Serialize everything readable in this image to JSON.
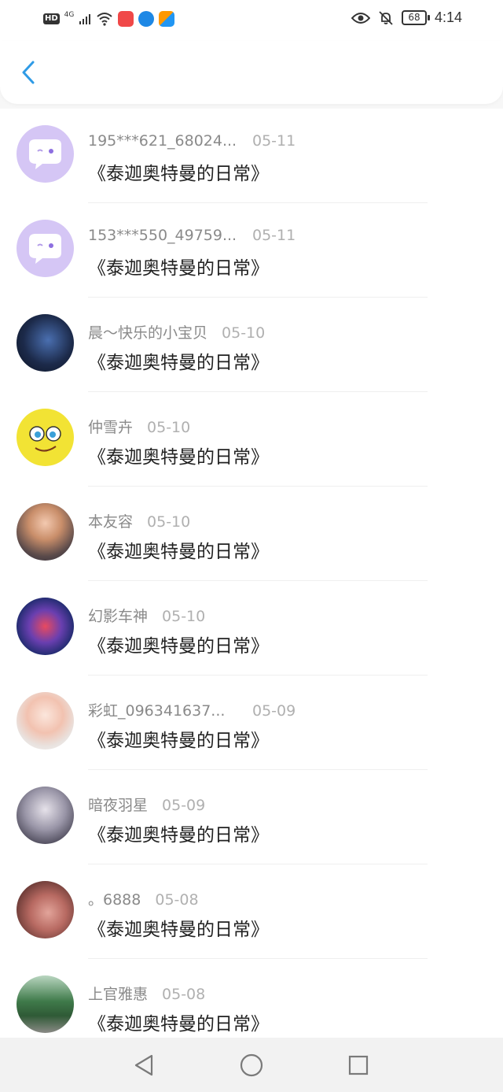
{
  "status": {
    "left_icons": [
      "hd-icon",
      "4g-signal-icon",
      "wifi-icon",
      "app-icon-shop",
      "app-icon-bulb",
      "app-icon-store"
    ],
    "hd_label": "HD",
    "net_label": "4G",
    "battery": "68",
    "time": "4:14"
  },
  "header": {
    "back_icon": "chevron-left-icon",
    "accent": "#2f9be6"
  },
  "items": [
    {
      "name": "195***621_68024...",
      "date": "05-11",
      "title": "《泰迦奥特曼的日常》",
      "avatar": "default-purple"
    },
    {
      "name": "153***550_49759...",
      "date": "05-11",
      "title": "《泰迦奥特曼的日常》",
      "avatar": "default-purple"
    },
    {
      "name": "晨～快乐的小宝贝",
      "date": "05-10",
      "title": "《泰迦奥特曼的日常》",
      "avatar": "photo"
    },
    {
      "name": "仲雪卉",
      "date": "05-10",
      "title": "《泰迦奥特曼的日常》",
      "avatar": "photo"
    },
    {
      "name": "本友容",
      "date": "05-10",
      "title": "《泰迦奥特曼的日常》",
      "avatar": "photo"
    },
    {
      "name": "幻影车神",
      "date": "05-10",
      "title": "《泰迦奥特曼的日常》",
      "avatar": "photo"
    },
    {
      "name": "彩虹_096341637...",
      "date": "05-09",
      "title": "《泰迦奥特曼的日常》",
      "avatar": "photo"
    },
    {
      "name": "暗夜羽星",
      "date": "05-09",
      "title": "《泰迦奥特曼的日常》",
      "avatar": "photo"
    },
    {
      "name": "。6888",
      "date": "05-08",
      "title": "《泰迦奥特曼的日常》",
      "avatar": "photo"
    },
    {
      "name": "上官雅惠",
      "date": "05-08",
      "title": "《泰迦奥特曼的日常》",
      "avatar": "photo"
    }
  ],
  "navbar": {
    "icons": [
      "back-triangle-icon",
      "home-circle-icon",
      "recents-square-icon"
    ]
  }
}
